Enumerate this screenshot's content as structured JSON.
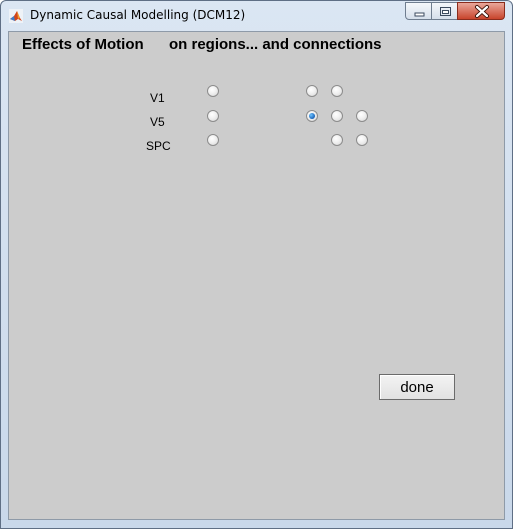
{
  "window": {
    "title": "Dynamic Causal Modelling (DCM12)"
  },
  "heading": {
    "left": "Effects of Motion",
    "right": "on regions... and connections"
  },
  "regions": [
    {
      "label": "V1",
      "region_checked": false
    },
    {
      "label": "V5",
      "region_checked": false
    },
    {
      "label": "SPC",
      "region_checked": false
    }
  ],
  "connections": [
    [
      false,
      false,
      null
    ],
    [
      true,
      false,
      false
    ],
    [
      null,
      false,
      false
    ]
  ],
  "done_label": "done",
  "colors": {
    "client_background": "#cccccc",
    "radio_selected": "#1a62b8"
  }
}
